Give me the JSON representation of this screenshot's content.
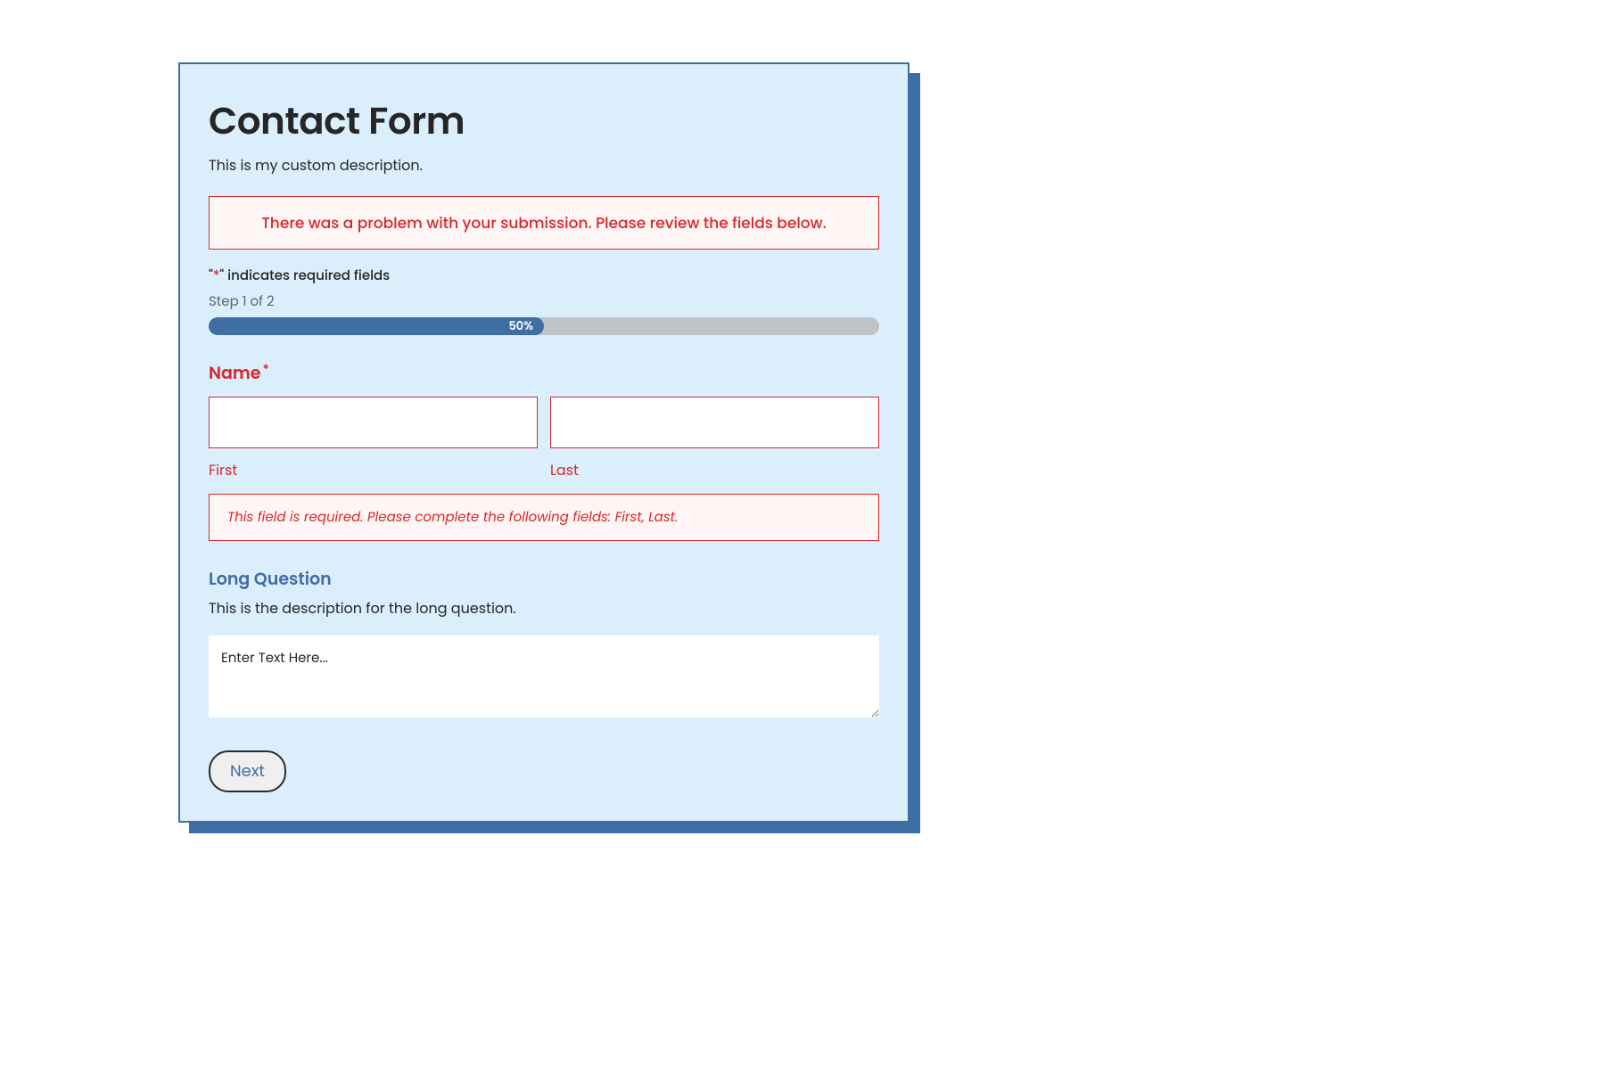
{
  "form": {
    "title": "Contact Form",
    "description": "This is my custom description.",
    "error_banner": "There was a problem with your submission. Please review the fields below.",
    "required_note_prefix": "\"",
    "required_note_asterisk": "*",
    "required_note_suffix": "\" indicates required fields",
    "step_label": "Step 1 of 2",
    "progress_percent": "50%",
    "name_section": {
      "label": "Name",
      "asterisk": "*",
      "first_sublabel": "First",
      "last_sublabel": "Last",
      "first_value": "",
      "last_value": "",
      "error_message": "This field is required. Please complete the following fields: First, Last."
    },
    "long_question": {
      "label": "Long Question",
      "description": "This is the description for the long question.",
      "placeholder": "Enter Text Here...",
      "value": ""
    },
    "next_button_label": "Next"
  }
}
